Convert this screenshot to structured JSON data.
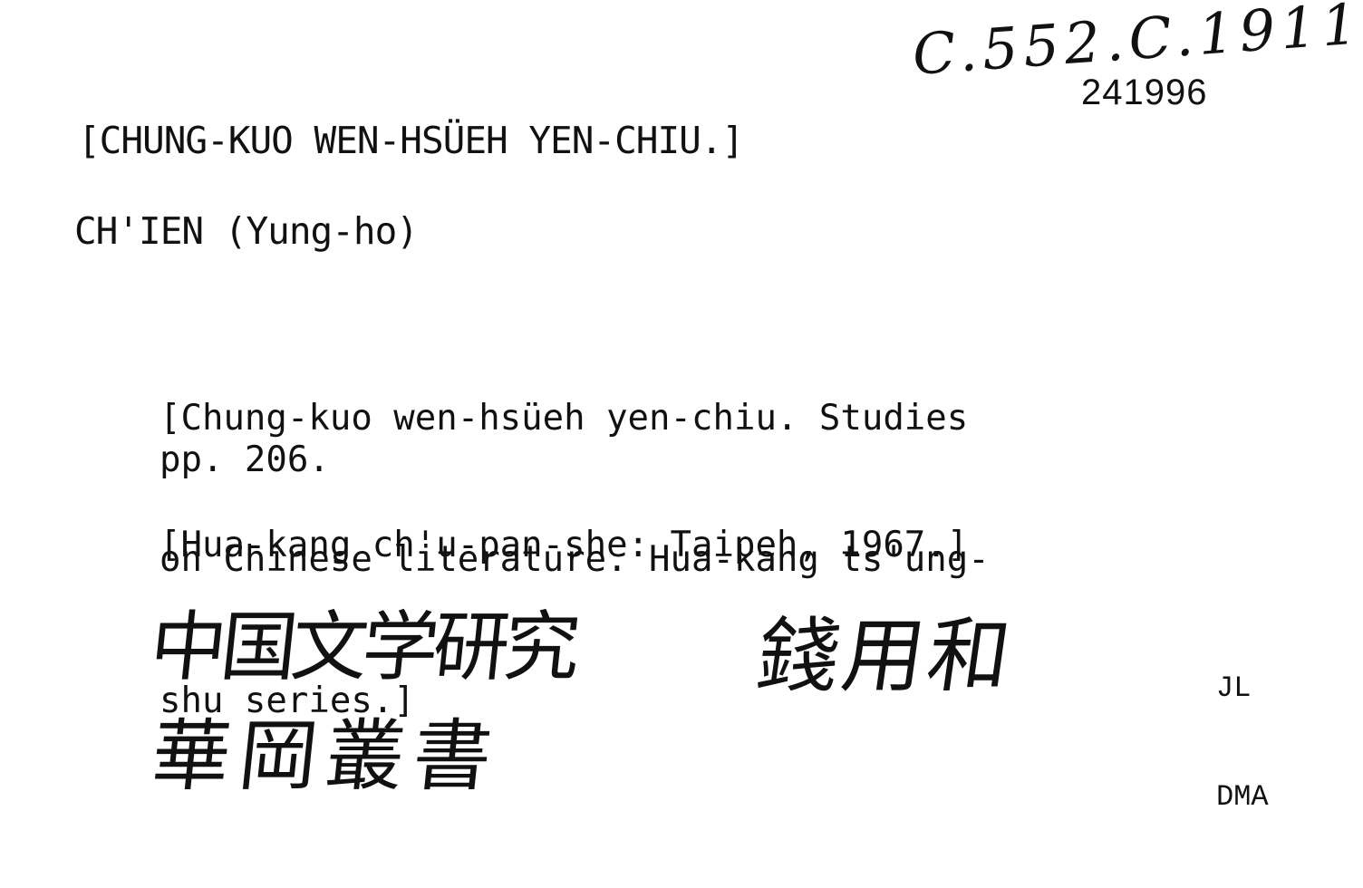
{
  "card": {
    "call_number": "C.552.C.1911",
    "accession_number": "241996",
    "title_heading": "[CHUNG-KUO WEN-HSÜEH YEN-CHIU.]",
    "author_heading": "CH'IEN (Yung-ho)",
    "description_lines": [
      "[Chung-kuo wen-hsüeh yen-chiu. Studies",
      "on Chinese literature. Hua-kang ts'ung-",
      "shu series.]"
    ],
    "pagination": "pp. 206.",
    "imprint": "[Hua-kang ch'u-pan-she: Taipeh, 1967.]",
    "cataloger_initials": [
      "JL",
      "DMA"
    ],
    "handwritten_title_cjk": "中国文学研究",
    "handwritten_series_cjk": "華岡叢書",
    "handwritten_author_cjk": "錢用和"
  }
}
